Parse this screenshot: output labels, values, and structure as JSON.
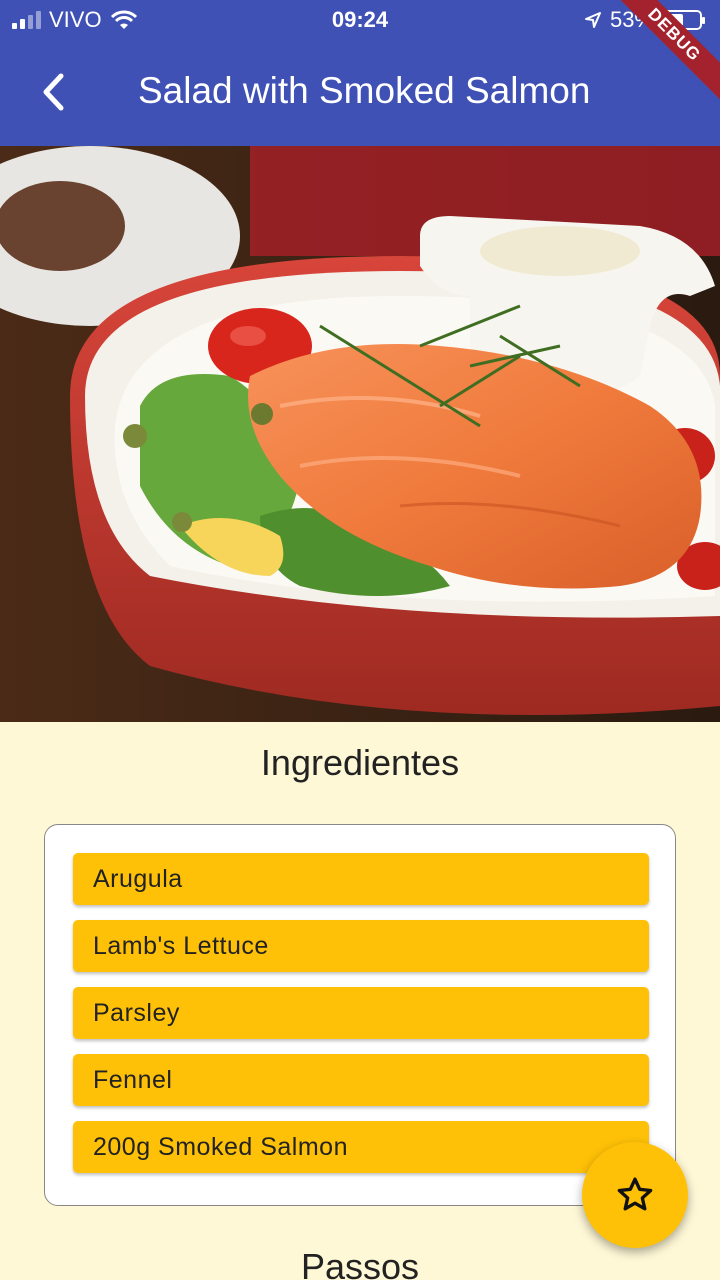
{
  "status_bar": {
    "carrier": "VIVO",
    "time": "09:24",
    "battery_percent": "53%",
    "battery_level": 0.53,
    "icons": [
      "signal-icon",
      "wifi-icon",
      "location-arrow-icon",
      "battery-icon"
    ]
  },
  "app_bar": {
    "title": "Salad with Smoked Salmon",
    "back_icon": "chevron-left-icon",
    "debug_banner": "DEBUG",
    "color": "#3f51b5"
  },
  "hero_image": {
    "description_icon": "food-photo"
  },
  "ingredients": {
    "heading": "Ingredientes",
    "items": [
      {
        "label": "Arugula"
      },
      {
        "label": "Lamb's Lettuce"
      },
      {
        "label": "Parsley"
      },
      {
        "label": "Fennel"
      },
      {
        "label": "200g Smoked Salmon"
      }
    ],
    "item_color": "#ffc107"
  },
  "steps": {
    "heading": "Passos"
  },
  "fab": {
    "icon": "star-outline-icon",
    "color": "#ffc107"
  }
}
